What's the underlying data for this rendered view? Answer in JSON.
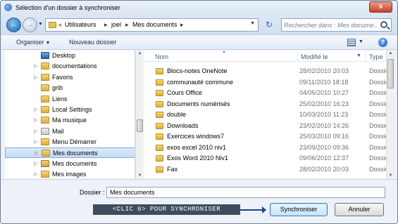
{
  "window": {
    "title": "Sélection d'un dossier à synchroniser",
    "close_label": "x"
  },
  "address": {
    "root_sep": "«",
    "crumbs": [
      "Utilisateurs",
      "joel",
      "Mes documents"
    ],
    "separator": "▸",
    "refresh": "↻"
  },
  "search": {
    "placeholder": "Rechercher dans : Mes docume..."
  },
  "toolbar": {
    "organize_label": "Organiser",
    "new_folder_label": "Nouveau dossier",
    "help_label": "?"
  },
  "nav": {
    "items": [
      {
        "label": "Desktop",
        "icon": "desktop-icon"
      },
      {
        "label": "documentations",
        "icon": "folder-icon"
      },
      {
        "label": "Favoris",
        "icon": "folder-icon"
      },
      {
        "label": "grib",
        "icon": "folder-icon"
      },
      {
        "label": "Liens",
        "icon": "folder-icon"
      },
      {
        "label": "Local Settings",
        "icon": "folder-icon"
      },
      {
        "label": "Ma musique",
        "icon": "music-folder-icon"
      },
      {
        "label": "Mail",
        "icon": "mail-icon"
      },
      {
        "label": "Menu Démarrer",
        "icon": "folder-icon"
      },
      {
        "label": "Mes documents",
        "icon": "folder-icon",
        "selected": true
      },
      {
        "label": "Mes documents",
        "icon": "library-icon"
      },
      {
        "label": "Mes images",
        "icon": "folder-icon"
      }
    ]
  },
  "files": {
    "columns": {
      "name": "Nom",
      "modified": "Modifié le",
      "type": "Type"
    },
    "rows": [
      {
        "name": "Blocs-notes OneNote",
        "modified": "28/02/2010 20:03",
        "type": "Dossier"
      },
      {
        "name": "communauté commune",
        "modified": "09/11/2010 18:18",
        "type": "Dossier"
      },
      {
        "name": "Cours Office",
        "modified": "04/05/2010 10:27",
        "type": "Dossier"
      },
      {
        "name": "Documents numérisés",
        "modified": "25/02/2010 16:23",
        "type": "Dossier"
      },
      {
        "name": "double",
        "modified": "10/03/2010 11:23",
        "type": "Dossier"
      },
      {
        "name": "Downloads",
        "modified": "23/02/2010 14:26",
        "type": "Dossier"
      },
      {
        "name": "Exercices windows7",
        "modified": "25/03/2010 09:16",
        "type": "Dossier"
      },
      {
        "name": "exos excel 2010 niv1",
        "modified": "23/09/2010 09:36",
        "type": "Dossier"
      },
      {
        "name": "Exos Word 2010 Niv1",
        "modified": "09/06/2010 12:37",
        "type": "Dossier"
      },
      {
        "name": "Fax",
        "modified": "28/02/2010 20:03",
        "type": "Dossier"
      }
    ]
  },
  "footer": {
    "folder_label": "Dossier :",
    "folder_value": "Mes documents",
    "annotation": "<CLIC 6> POUR SYNCHRONISER",
    "sync_button": "Synchroniser",
    "cancel_button": "Annuler"
  }
}
